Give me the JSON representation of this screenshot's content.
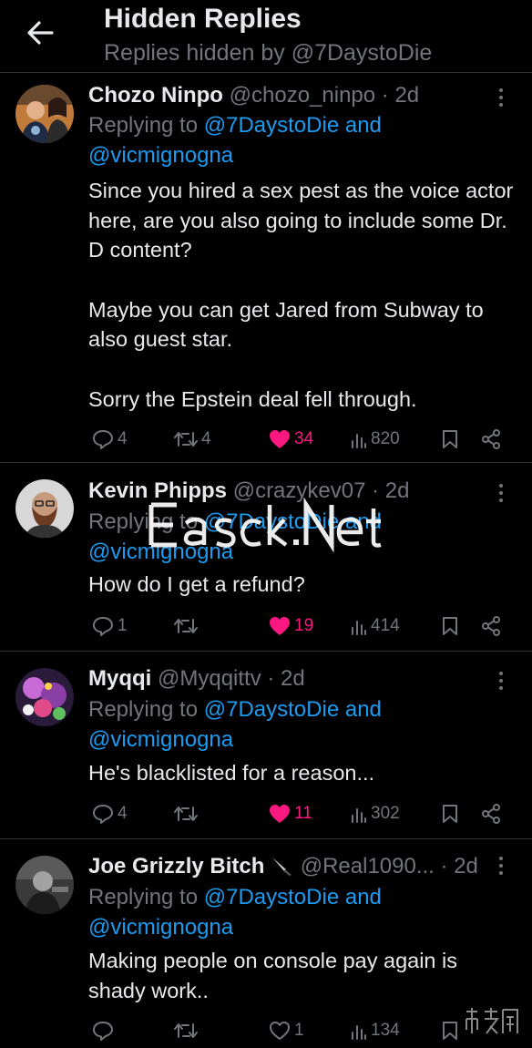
{
  "header": {
    "title": "Hidden Replies",
    "subtitle": "Replies hidden by @7DaystoDie"
  },
  "reply_prefix": "Replying to",
  "tweets": [
    {
      "name": "Chozo Ninpo",
      "handle": "@chozo_ninpo",
      "time": "· 2d",
      "mention1": "@7DaystoDie",
      "and": "and",
      "mention2": "@vicmignogna",
      "paragraphs": [
        "Since you hired a sex pest as the voice actor here, are you also going to include some Dr. D content?",
        "Maybe you can get Jared from Subway to also guest star.",
        "Sorry the Epstein deal fell through."
      ],
      "replies": "4",
      "reposts": "4",
      "likes": "34",
      "views": "820"
    },
    {
      "name": "Kevin Phipps",
      "handle": "@crazykev07",
      "time": "· 2d",
      "mention1": "@7DaystoDie",
      "and": "and",
      "mention2": "@vicmignogna",
      "paragraphs": [
        "How do I get a refund?"
      ],
      "replies": "1",
      "reposts": "",
      "likes": "19",
      "views": "414"
    },
    {
      "name": "Myqqi",
      "handle": "@Myqqittv",
      "time": "· 2d",
      "mention1": "@7DaystoDie",
      "and": "and",
      "mention2": "@vicmignogna",
      "paragraphs": [
        "He's blacklisted for a reason..."
      ],
      "replies": "4",
      "reposts": "",
      "likes": "11",
      "views": "302"
    },
    {
      "name": "Joe Grizzly Bitch",
      "handle": "@Real1090...",
      "time": "· 2d",
      "mention1": "@7DaystoDie",
      "and": "and",
      "mention2": "@vicmignogna",
      "paragraphs": [
        "Making people on console pay again is shady work.."
      ],
      "replies": "",
      "reposts": "",
      "likes": "1",
      "views": "134"
    }
  ],
  "watermark": "Easck.Net",
  "corner_watermark": "市场网",
  "colors": {
    "background": "#000000",
    "text": "#e7e9ea",
    "muted": "#71767b",
    "link": "#1d9bf0",
    "like": "#f91880",
    "divider": "#2f3336"
  }
}
